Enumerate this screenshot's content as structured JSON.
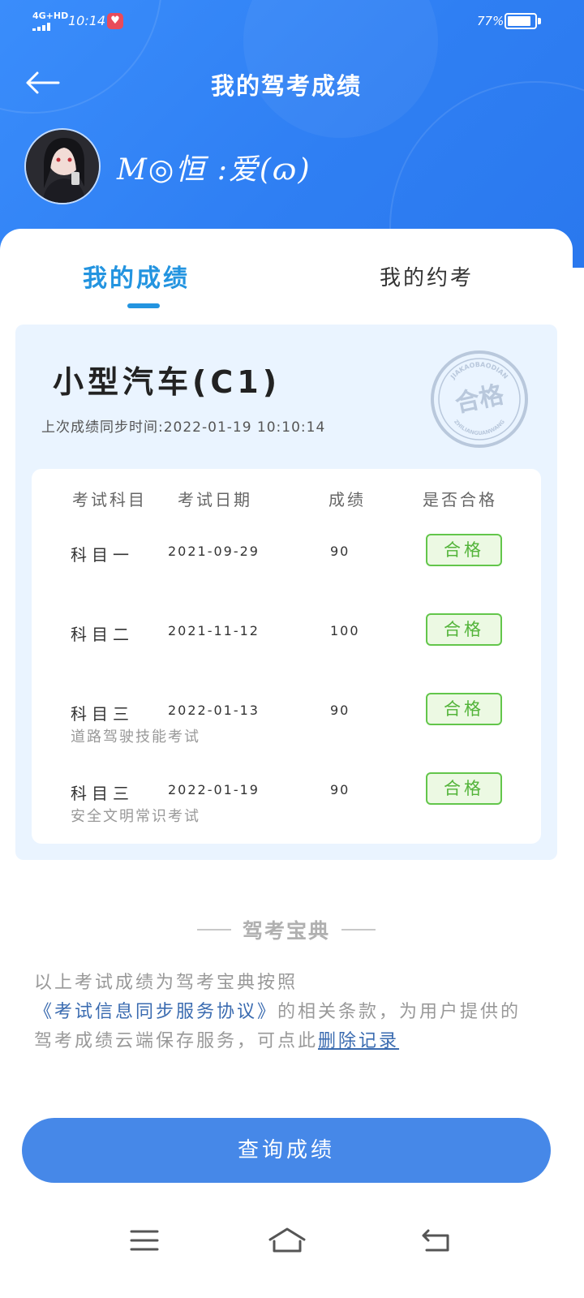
{
  "status_bar": {
    "network": "4G+HD",
    "time": "10:14",
    "app_icon": "♥",
    "battery_percent": "77%",
    "battery_level": 0.77
  },
  "header": {
    "title": "我的驾考成绩",
    "username": "M◎恒 :爱(ɷ)"
  },
  "tabs": [
    {
      "label": "我的成绩",
      "active": true
    },
    {
      "label": "我的约考",
      "active": false
    }
  ],
  "license": {
    "type": "小型汽车(C1)",
    "sync_time": "上次成绩同步时间:2022-01-19 10:10:14",
    "stamp": {
      "text": "合格",
      "top_text": "JIAKAOBAODIAN",
      "bottom_text": "ZHILIANGUANWANG"
    }
  },
  "table": {
    "headers": [
      "考试科目",
      "考试日期",
      "成绩",
      "是否合格"
    ],
    "rows": [
      {
        "subject": "科目一",
        "date": "2021-09-29",
        "score": "90",
        "result": "合格",
        "sub": ""
      },
      {
        "subject": "科目二",
        "date": "2021-11-12",
        "score": "100",
        "result": "合格",
        "sub": ""
      },
      {
        "subject": "科目三",
        "date": "2022-01-13",
        "score": "90",
        "result": "合格",
        "sub": "道路驾驶技能考试"
      },
      {
        "subject": "科目三",
        "date": "2022-01-19",
        "score": "90",
        "result": "合格",
        "sub": "安全文明常识考试"
      }
    ]
  },
  "brand": {
    "name": "驾考宝典"
  },
  "disclaimer": {
    "text_before": "以上考试成绩为驾考宝典按照",
    "agreement_link": "《考试信息同步服务协议》",
    "text_middle": "的相关条款，为用户提供的驾考成绩云端保存服务，可点此",
    "delete_link": "删除记录"
  },
  "primary_button": {
    "label": "查询成绩"
  },
  "colors": {
    "header_blue": "#2f7ff3",
    "accent_blue": "#2394e0",
    "button_blue": "#4688e8",
    "pass_green": "#63c64b",
    "card_bg": "#eaf4ff"
  },
  "nav_bar": {
    "icons": [
      "menu-icon",
      "home-icon",
      "back-icon"
    ]
  }
}
